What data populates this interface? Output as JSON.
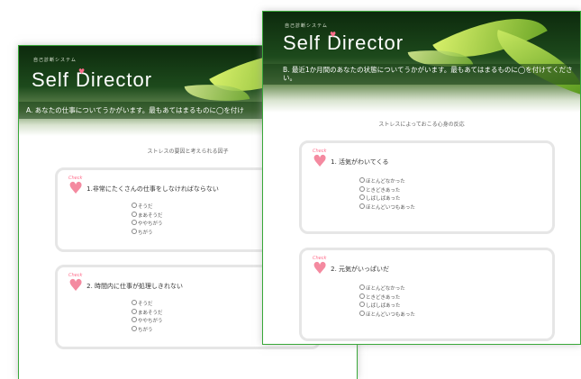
{
  "back_window": {
    "system_name": "自己診断システム",
    "app_title": "Self Director",
    "section_header": "A. あなたの仕事についてうかがいます。最もあてはまるものに◯を付け",
    "subtitle": "ストレスの要因と考えられる因子",
    "check_label": "Check",
    "questions": [
      {
        "number": "1",
        "text": "1.非常にたくさんの仕事をしなければならない",
        "options": [
          "そうだ",
          "まあそうだ",
          "ややちがう",
          "ちがう"
        ]
      },
      {
        "number": "2",
        "text": "2. 時間内に仕事が処理しきれない",
        "options": [
          "そうだ",
          "まあそうだ",
          "ややちがう",
          "ちがう"
        ]
      }
    ]
  },
  "front_window": {
    "system_name": "自己診断システム",
    "app_title": "Self Director",
    "section_header": "B. 最近1か月間のあなたの状態についてうかがいます。最もあてはまるものに◯を付けてください。",
    "subtitle": "ストレスによっておこる心身の反応",
    "check_label": "Check",
    "questions": [
      {
        "number": "1",
        "text": "1. 活気がわいてくる",
        "options": [
          "ほとんどなかった",
          "ときどきあった",
          "しばしばあった",
          "ほとんどいつもあった"
        ]
      },
      {
        "number": "2",
        "text": "2. 元気がいっぱいだ",
        "options": [
          "ほとんどなかった",
          "ときどきあった",
          "しばしばあった",
          "ほとんどいつもあった"
        ]
      }
    ]
  },
  "colors": {
    "window_border": "#39a839",
    "accent_pink": "#ff6b8a",
    "box_border": "#e6e6e6"
  }
}
